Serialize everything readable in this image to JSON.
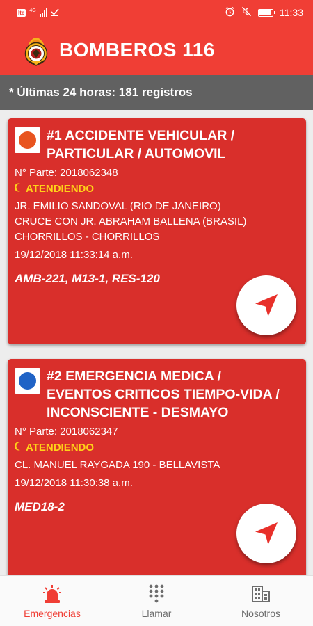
{
  "status_bar": {
    "carrier_chip": "lte",
    "network": "4G",
    "time": "11:33"
  },
  "app": {
    "title": "BOMBEROS 116"
  },
  "summary": {
    "text": "* Últimas 24 horas: 181 registros"
  },
  "emergencies": [
    {
      "title_lines": [
        "#1 ACCIDENTE VEHICULAR /",
        "PARTICULAR / AUTOMOVIL"
      ],
      "type_color": "#e8541f",
      "parte": "N° Parte: 2018062348",
      "status": "ATENDIENDO",
      "address_lines": [
        "JR. EMILIO SANDOVAL (RIO DE JANEIRO)",
        "CRUCE CON JR. ABRAHAM BALLENA (BRASIL)",
        "CHORRILLOS  - CHORRILLOS"
      ],
      "datetime": "19/12/2018 11:33:14 a.m.",
      "units": "AMB-221, M13-1, RES-120"
    },
    {
      "title_lines": [
        "#2 EMERGENCIA MEDICA /",
        "EVENTOS CRITICOS TIEMPO-VIDA /",
        "INCONSCIENTE - DESMAYO"
      ],
      "type_color": "#1f63c6",
      "parte": "N° Parte: 2018062347",
      "status": "ATENDIENDO",
      "address_lines": [
        "CL. MANUEL RAYGADA 190 - BELLAVISTA"
      ],
      "datetime": "19/12/2018 11:30:38 a.m.",
      "units": "MED18-2"
    }
  ],
  "bottom_nav": [
    {
      "label": "Emergencias",
      "icon": "alarm-bell-icon",
      "active": true
    },
    {
      "label": "Llamar",
      "icon": "dialpad-icon",
      "active": false
    },
    {
      "label": "Nosotros",
      "icon": "building-icon",
      "active": false
    }
  ],
  "colors": {
    "primary": "#f03e35",
    "card": "#d92f2b",
    "status": "#ffd118",
    "summary_bg": "#616161"
  }
}
